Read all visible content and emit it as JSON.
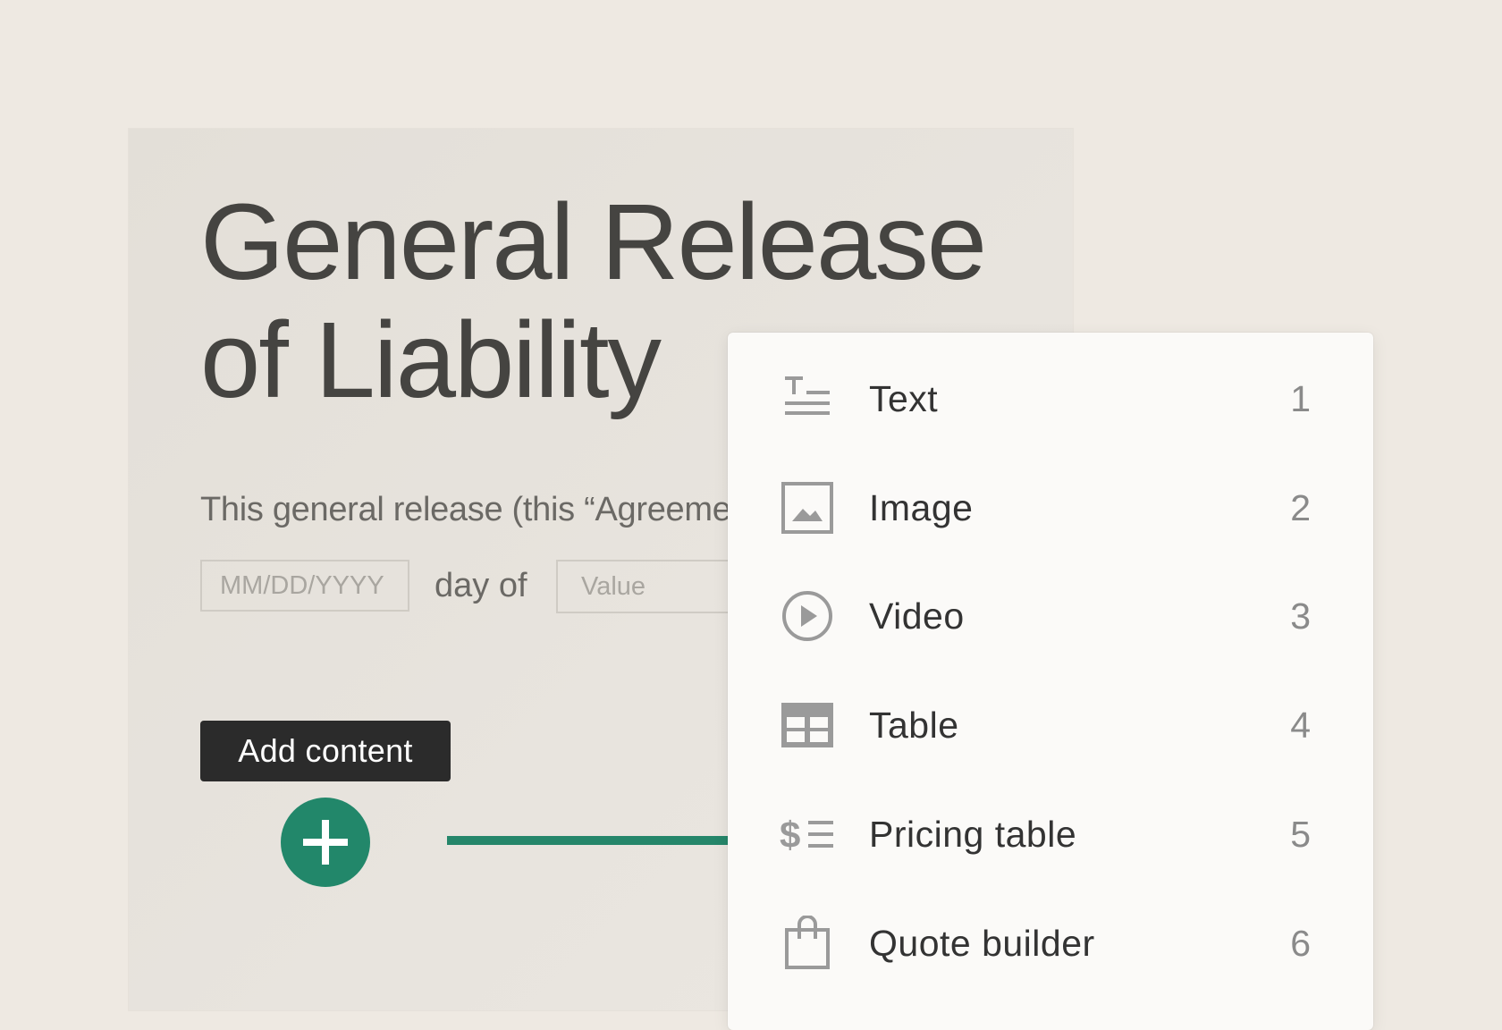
{
  "document": {
    "title_line1": "General Release",
    "title_line2": "of Liability",
    "body_text": "This general release (this “Agreement”",
    "date_placeholder": "MM/DD/YYYY",
    "day_of": "day of",
    "value_placeholder": "Value"
  },
  "tooltip": {
    "add_content": "Add content"
  },
  "add_button": {
    "icon": "plus-icon",
    "color": "#22876a"
  },
  "menu": {
    "items": [
      {
        "label": "Text",
        "shortcut": "1",
        "icon": "text-icon"
      },
      {
        "label": "Image",
        "shortcut": "2",
        "icon": "image-icon"
      },
      {
        "label": "Video",
        "shortcut": "3",
        "icon": "video-icon"
      },
      {
        "label": "Table",
        "shortcut": "4",
        "icon": "table-icon"
      },
      {
        "label": "Pricing table",
        "shortcut": "5",
        "icon": "pricing-table-icon"
      },
      {
        "label": "Quote builder",
        "shortcut": "6",
        "icon": "shopping-bag-icon"
      }
    ]
  }
}
